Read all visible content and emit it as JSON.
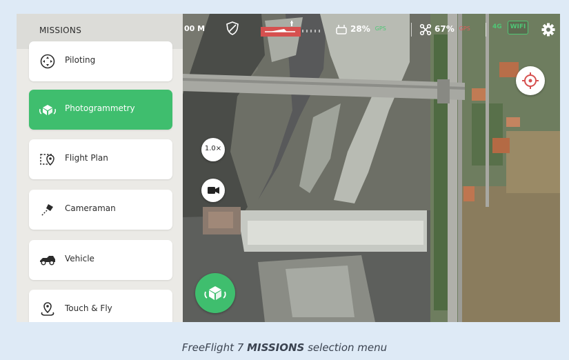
{
  "sidebar": {
    "title": "MISSIONS",
    "items": [
      {
        "label": "Piloting",
        "icon": "piloting-icon",
        "active": false
      },
      {
        "label": "Photogrammetry",
        "icon": "photogrammetry-cube-icon",
        "active": true
      },
      {
        "label": "Flight Plan",
        "icon": "flight-plan-icon",
        "active": false
      },
      {
        "label": "Cameraman",
        "icon": "cameraman-icon",
        "active": false
      },
      {
        "label": "Vehicle",
        "icon": "vehicle-icon",
        "active": false
      },
      {
        "label": "Touch & Fly",
        "icon": "touch-and-fly-icon",
        "active": false
      }
    ]
  },
  "topbar": {
    "distance": "00 M",
    "controller_battery": "28%",
    "controller_gps": "GPS",
    "drone_battery": "67%",
    "drone_gps": "GPS",
    "network_4g": "4G",
    "wifi": "WIFI"
  },
  "controls": {
    "zoom": "1.0×"
  },
  "caption": {
    "prefix": "FreeFlight 7 ",
    "bold": "MISSIONS",
    "suffix": " selection menu"
  },
  "colors": {
    "accent_green": "#3fbe6e",
    "alert_red": "#d6504f",
    "page_background": "#deeaf6"
  }
}
